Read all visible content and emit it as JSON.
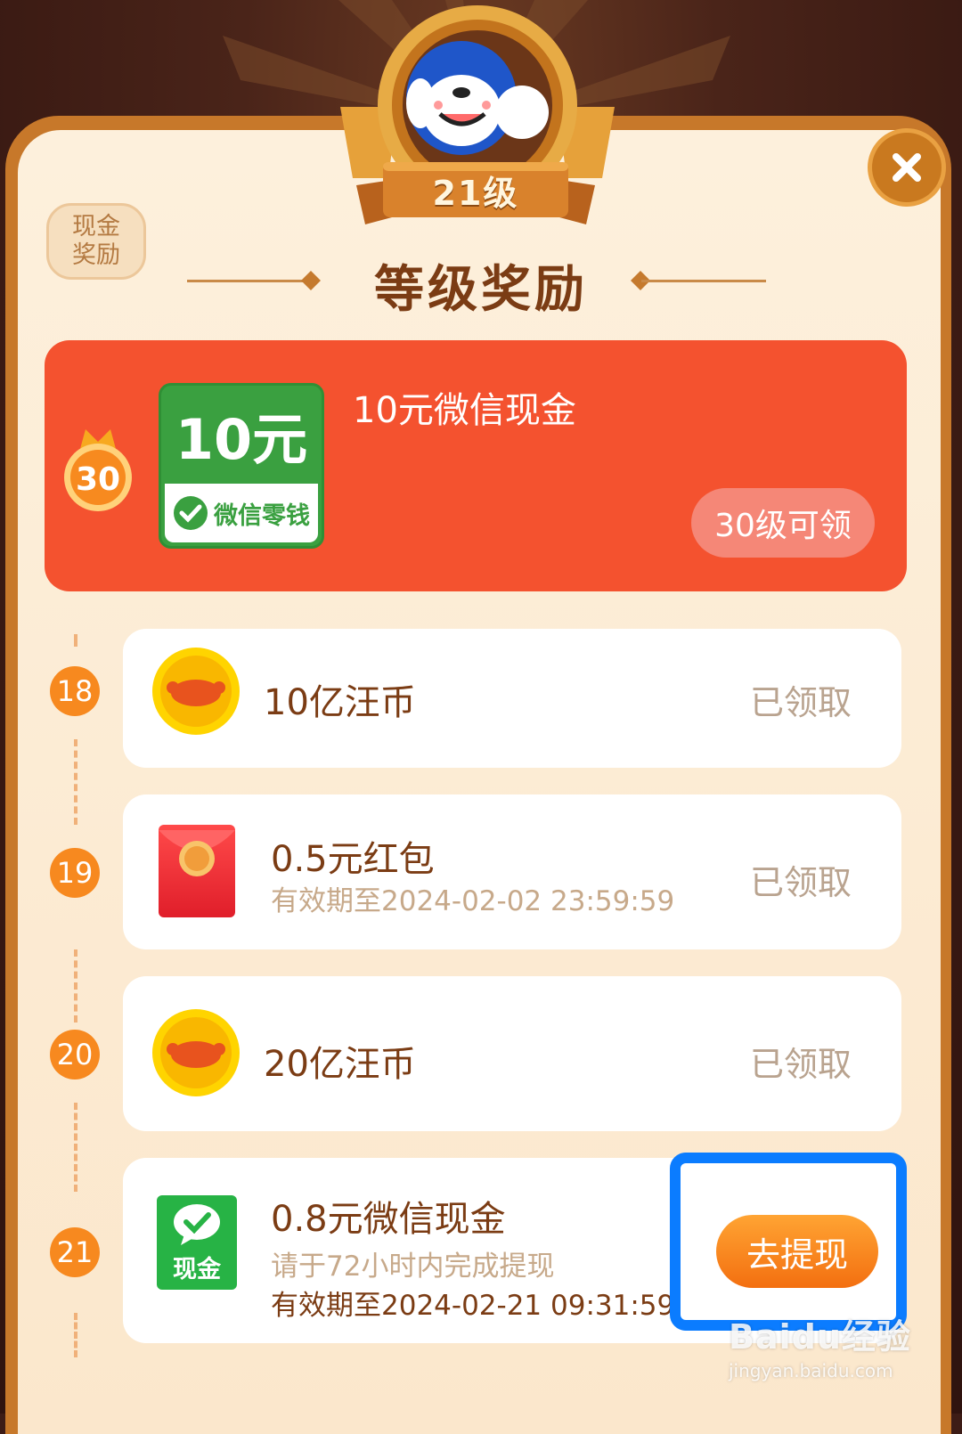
{
  "header": {
    "level_label": "21级",
    "cash_tag_line1": "现金",
    "cash_tag_line2": "奖励",
    "title": "等级奖励"
  },
  "featured": {
    "level": "30",
    "card_amount": "10元",
    "card_caption": "微信零钱",
    "title": "10元微信现金",
    "claim_label": "30级可领"
  },
  "rewards": [
    {
      "level": "18",
      "title": "10亿汪币",
      "status": "已领取",
      "icon": "coin-icon"
    },
    {
      "level": "19",
      "title": "0.5元红包",
      "validity": "有效期至2024-02-02 23:59:59",
      "status": "已领取",
      "icon": "red-packet-icon"
    },
    {
      "level": "20",
      "title": "20亿汪币",
      "status": "已领取",
      "icon": "coin-icon"
    },
    {
      "level": "21",
      "title": "0.8元微信现金",
      "note": "请于72小时内完成提现",
      "validity": "有效期至2024-02-21 09:31:59",
      "action_label": "去提现",
      "icon_label": "现金",
      "icon": "wechat-cash-icon"
    }
  ],
  "watermark": {
    "main": "Baidu经验",
    "sub": "jingyan.baidu.com"
  },
  "colors": {
    "accent_red": "#f4522f",
    "accent_orange": "#f7891f",
    "highlight_blue": "#0b7cff",
    "wechat_green": "#3aa040"
  }
}
